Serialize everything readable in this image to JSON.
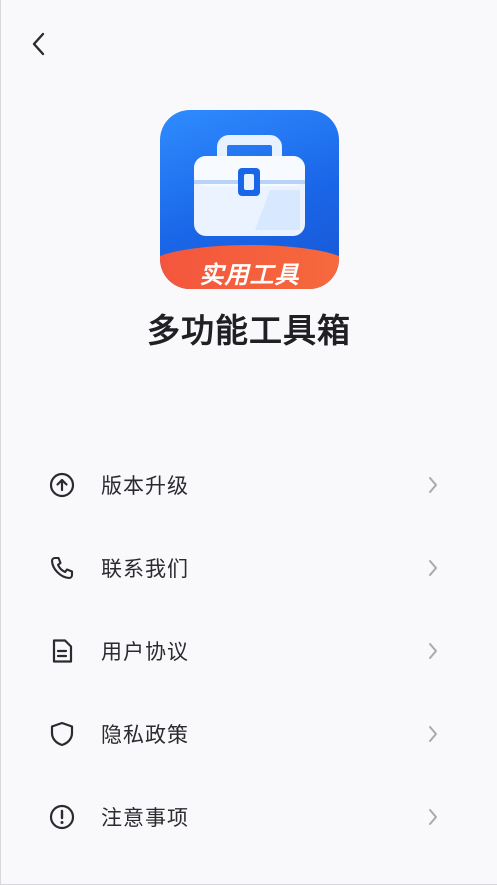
{
  "app": {
    "name": "多功能工具箱",
    "icon_badge": "实用工具"
  },
  "nav": {
    "back_icon": "chevron-left-icon"
  },
  "menu": {
    "items": [
      {
        "label": "版本升级",
        "icon": "arrow-up-circle-icon"
      },
      {
        "label": "联系我们",
        "icon": "phone-icon"
      },
      {
        "label": "用户协议",
        "icon": "document-icon"
      },
      {
        "label": "隐私政策",
        "icon": "shield-icon"
      },
      {
        "label": "注意事项",
        "icon": "alert-circle-icon"
      }
    ]
  },
  "colors": {
    "icon_blue": "#1a66e8",
    "ribbon_orange": "#f3553d",
    "text": "#2a2a30",
    "chevron": "#a8a8b0",
    "background": "#f9f9fb"
  }
}
